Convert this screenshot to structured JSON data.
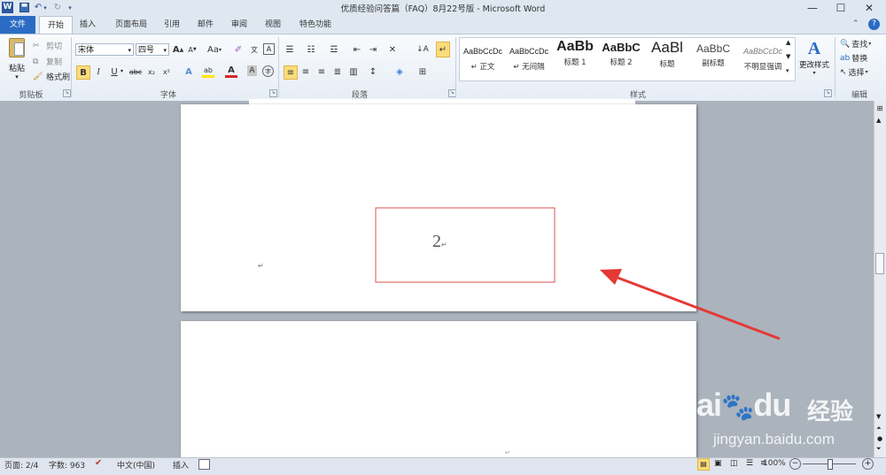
{
  "window": {
    "title": "优质经验问答篇（FAQ）8月22号版 - Microsoft Word",
    "app_icon": "word-icon"
  },
  "qat": {
    "save_icon": "save-icon",
    "undo_icon": "undo-icon",
    "redo_icon": "redo-icon",
    "customize_icon": "dropdown-icon"
  },
  "tabs": [
    {
      "label": "文件"
    },
    {
      "label": "开始"
    },
    {
      "label": "插入"
    },
    {
      "label": "页面布局"
    },
    {
      "label": "引用"
    },
    {
      "label": "邮件"
    },
    {
      "label": "审阅"
    },
    {
      "label": "视图"
    },
    {
      "label": "特色功能"
    }
  ],
  "ribbon": {
    "clipboard": {
      "paste": "粘贴",
      "cut": "剪切",
      "copy": "复制",
      "format_painter": "格式刷",
      "group": "剪贴板"
    },
    "font": {
      "font_name": "宋体",
      "font_size": "四号",
      "group": "字体",
      "grow": "A",
      "shrink": "A",
      "case": "Aa",
      "bold": "B",
      "italic": "I",
      "underline": "U",
      "strike": "abc",
      "subscript": "x₂",
      "superscript": "x²",
      "font_color": "A",
      "char_shading": "A",
      "enclose": "字"
    },
    "paragraph": {
      "group": "段落"
    },
    "styles": {
      "group": "样式",
      "items": [
        {
          "preview": "AaBbCcDc",
          "label": "↵ 正文"
        },
        {
          "preview": "AaBbCcDc",
          "label": "↵ 无间隔"
        },
        {
          "preview": "AaBb",
          "label": "标题 1"
        },
        {
          "preview": "AaBbC",
          "label": "标题 2"
        },
        {
          "preview": "AaBl",
          "label": "标题"
        },
        {
          "preview": "AaBbC",
          "label": "副标题"
        },
        {
          "preview": "AaBbCcDc",
          "label": "不明显强调"
        }
      ],
      "change_styles": "更改样式"
    },
    "editing": {
      "find": "查找",
      "replace": "替换",
      "select": "选择",
      "group": "编辑"
    }
  },
  "document": {
    "page_number_text": "2",
    "paragraph_mark": "↵"
  },
  "annotation": {
    "box_color": "#d9534f",
    "arrow_color": "#e53935"
  },
  "status": {
    "page": "页面: 2/4",
    "words": "字数: 963",
    "language": "中文(中国)",
    "mode": "插入",
    "zoom": "100%"
  },
  "watermark": {
    "brand": "Bai",
    "brand2": "du",
    "cn": "经验",
    "url": "jingyan.baidu.com"
  },
  "colors": {
    "file_tab": "#2a6cc4",
    "ribbon_bg": "#f9fbfd",
    "doc_bg": "#abb3bd"
  }
}
